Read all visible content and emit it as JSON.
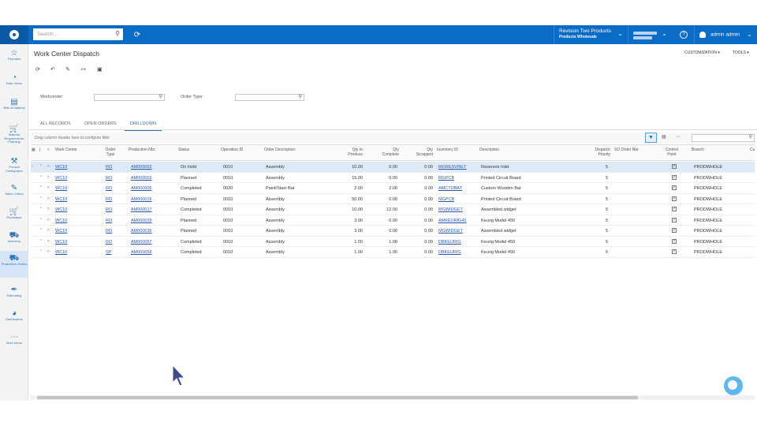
{
  "topbar": {
    "search_placeholder": "Search...",
    "company_line1": "Revision Two Products",
    "company_line2": "Products Wholesale",
    "user_name": "admin admin"
  },
  "sidebar": {
    "items": [
      {
        "label": "Favorites",
        "icon": "star-icon"
      },
      {
        "label": "Data Views",
        "icon": "pie-chart-icon"
      },
      {
        "label": "Bills of Material",
        "icon": "document-icon"
      },
      {
        "label": "Material Requirements Planning",
        "icon": "cart-icon"
      },
      {
        "label": "Product Configurator",
        "icon": "wrench-icon"
      },
      {
        "label": "Sales Orders",
        "icon": "edit-icon"
      },
      {
        "label": "Purchases",
        "icon": "basket-icon"
      },
      {
        "label": "Inventory",
        "icon": "truck-icon"
      },
      {
        "label": "Production Orders",
        "icon": "factory-icon"
      },
      {
        "label": "Estimating",
        "icon": "pen-icon"
      },
      {
        "label": "Dashboards",
        "icon": "gauge-icon"
      },
      {
        "label": "More Items",
        "icon": "grid-icon"
      }
    ]
  },
  "page": {
    "title": "Work Center Dispatch",
    "customization": "CUSTOMIZATION",
    "tools": "TOOLS"
  },
  "filters": {
    "workcenter_label": "Workcenter:",
    "order_type_label": "Order Type:"
  },
  "tabs": [
    "ALL RECORDS",
    "OPEN ORDERS",
    "DRILLDOWN"
  ],
  "grid": {
    "hint": "Drag column header here to configure filter",
    "columns": {
      "work_center": "Work Center",
      "order_type": "Order Type",
      "production_nbr": "Production Nbr.",
      "status": "Status",
      "operation_id": "Operation ID",
      "order_description": "Order Description",
      "qty_to_produce": "Qty to Produce",
      "qty_complete": "Qty Complete",
      "qty_scrapped": "Qty Scrapped",
      "inventory_id": "Inventory ID",
      "description": "Description",
      "dispatch_priority": "Dispatch Priority",
      "so_order_nbr": "SO Order Nbr",
      "control_point": "Control Point",
      "branch": "Branch",
      "cu": "Cu"
    },
    "rows": [
      {
        "wc": "WC10",
        "type": "RO",
        "prod": "AM000002",
        "status": "On Hold",
        "op": "0010",
        "odesc": "Assembly",
        "qtp": "10.00",
        "qc": "0.00",
        "qs": "0.00",
        "inv": "MGRESVINLT",
        "desc": "Reservoir Inlet",
        "prio": "5",
        "branch": "PRODWHOLE"
      },
      {
        "wc": "WC10",
        "type": "RO",
        "prod": "AM000003",
        "status": "Planned",
        "op": "0010",
        "odesc": "Assembly",
        "qtp": "15.00",
        "qc": "0.00",
        "qs": "0.00",
        "inv": "MGPCB",
        "desc": "Printed Circuit Board",
        "prio": "5",
        "branch": "PRODWHOLE"
      },
      {
        "wc": "WC10",
        "type": "RO",
        "prod": "AM000006",
        "status": "Completed",
        "op": "0020",
        "odesc": "Paint/Stain Bat",
        "qtp": "2.00",
        "qc": "2.00",
        "qs": "0.00",
        "inv": "AMCTOBAT",
        "desc": "Custom Wooden Bat",
        "prio": "5",
        "branch": "PRODWHOLE"
      },
      {
        "wc": "WC10",
        "type": "RO",
        "prod": "AM000016",
        "status": "Planned",
        "op": "0010",
        "odesc": "Assembly",
        "qtp": "50.00",
        "qc": "0.00",
        "qs": "0.00",
        "inv": "MGPCB",
        "desc": "Printed Circuit Board",
        "prio": "5",
        "branch": "PRODWHOLE"
      },
      {
        "wc": "WC10",
        "type": "RO",
        "prod": "AM000017",
        "status": "Completed",
        "op": "0010",
        "odesc": "Assembly",
        "qtp": "10.00",
        "qc": "12.00",
        "qs": "0.00",
        "inv": "MGWIDGET",
        "desc": "Assembled widget",
        "prio": "5",
        "branch": "PRODWHOLE"
      },
      {
        "wc": "WC10",
        "type": "RO",
        "prod": "AM000029",
        "status": "Planned",
        "op": "0010",
        "odesc": "Assembly",
        "qtp": "3.00",
        "qc": "0.00",
        "qs": "0.00",
        "inv": "AMKEURIG45",
        "desc": "Keurig Model 450",
        "prio": "5",
        "branch": "PRODWHOLE"
      },
      {
        "wc": "WC10",
        "type": "RO",
        "prod": "AM000036",
        "status": "Planned",
        "op": "0010",
        "odesc": "Assembly",
        "qtp": "3.00",
        "qc": "0.00",
        "qs": "0.00",
        "inv": "MGWIDGET",
        "desc": "Assembled widget",
        "prio": "5",
        "branch": "PRODWHOLE"
      },
      {
        "wc": "WC10",
        "type": "RO",
        "prod": "AM000057",
        "status": "Completed",
        "op": "0010",
        "odesc": "Assembly",
        "qtp": "1.00",
        "qc": "1.00",
        "qs": "0.00",
        "inv": "DBKEURIG",
        "desc": "Keurig Model 450",
        "prio": "5",
        "branch": "PRODWHOLE"
      },
      {
        "wc": "WC10",
        "type": "SP",
        "prod": "AM000058",
        "status": "Completed",
        "op": "0010",
        "odesc": "Assembly",
        "qtp": "1.00",
        "qc": "1.00",
        "qs": "0.00",
        "inv": "DBKEURIG",
        "desc": "Keurig Model 450",
        "prio": "5",
        "branch": "PRODWHOLE"
      }
    ]
  }
}
